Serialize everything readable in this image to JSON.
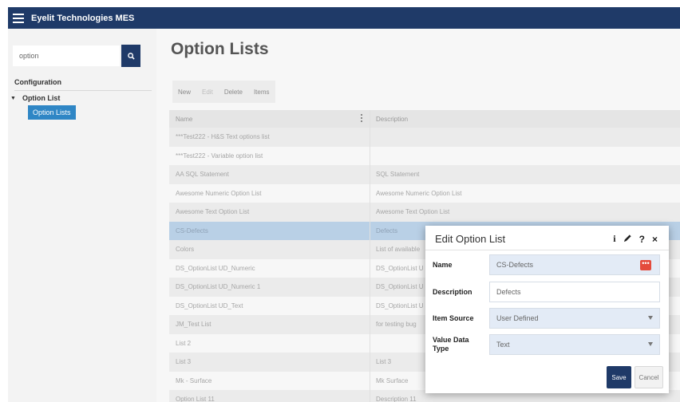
{
  "app": {
    "title": "Eyelit Technologies MES"
  },
  "sidebar": {
    "search": {
      "value": "option"
    },
    "section_title": "Configuration",
    "tree": {
      "node_label": "Option List",
      "leaf_label": "Option Lists"
    }
  },
  "main": {
    "title": "Option Lists",
    "toolbar": {
      "new": "New",
      "edit": "Edit",
      "delete": "Delete",
      "items": "Items"
    },
    "grid": {
      "headers": {
        "name": "Name",
        "description": "Description"
      },
      "rows": [
        {
          "name": "***Test222 - H&S Text options list",
          "description": ""
        },
        {
          "name": "***Test222 - Variable option list",
          "description": ""
        },
        {
          "name": "AA SQL Statement",
          "description": "SQL Statement"
        },
        {
          "name": "Awesome Numeric Option List",
          "description": "Awesome Numeric Option List"
        },
        {
          "name": "Awesome Text Option List",
          "description": "Awesome Text Option List"
        },
        {
          "name": "CS-Defects",
          "description": "Defects"
        },
        {
          "name": "Colors",
          "description": "List of available"
        },
        {
          "name": "DS_OptionList UD_Numeric",
          "description": "DS_OptionList U"
        },
        {
          "name": "DS_OptionList UD_Numeric 1",
          "description": "DS_OptionList U"
        },
        {
          "name": "DS_OptionList UD_Text",
          "description": "DS_OptionList U"
        },
        {
          "name": "JM_Test List",
          "description": "for testing bug"
        },
        {
          "name": "List 2",
          "description": ""
        },
        {
          "name": "List 3",
          "description": "List 3"
        },
        {
          "name": "Mk - Surface",
          "description": "Mk Surface"
        },
        {
          "name": "Option List 11",
          "description": "Description 11"
        }
      ]
    }
  },
  "dialog": {
    "title": "Edit Option List",
    "icons": {
      "info": "i",
      "help": "?",
      "close": "×"
    },
    "fields": {
      "name_label": "Name",
      "name_value": "CS-Defects",
      "description_label": "Description",
      "description_value": "Defects",
      "item_source_label": "Item Source",
      "item_source_value": "User Defined",
      "value_type_label": "Value Data Type",
      "value_type_value": "Text"
    },
    "buttons": {
      "save": "Save",
      "cancel": "Cancel"
    }
  },
  "colors": {
    "topbar": "#1f3a68",
    "selection": "#2f86c5",
    "selected_row": "#b9d0e6",
    "dots_button": "#e44b3c"
  }
}
